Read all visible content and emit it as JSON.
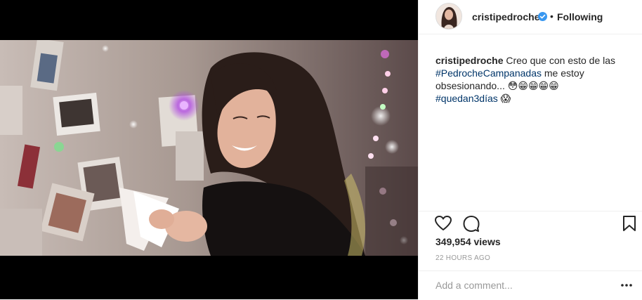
{
  "post": {
    "username": "cristipedroche",
    "follow_separator": "•",
    "follow_status": "Following",
    "caption": {
      "user": "cristipedroche",
      "text1": " Creo que con esto de las ",
      "hashtag1": "#PedrocheCampanadas",
      "text2": " me estoy obsesionando... ",
      "emojis1": "😳😁😁😁😁",
      "hashtag2": "#quedan3días",
      "emojis2": " 😱"
    },
    "views": "349,954 views",
    "timestamp": "22 HOURS AGO",
    "comment_placeholder": "Add a comment...",
    "more_glyph": "•••"
  },
  "icons": {
    "verified": "verified-badge-icon",
    "like": "heart-icon",
    "comment": "comment-bubble-icon",
    "save": "bookmark-icon",
    "more": "more-options-icon"
  },
  "colors": {
    "hashtag": "#003569",
    "verified": "#3897f0",
    "muted": "#999999",
    "border": "#efefef"
  }
}
